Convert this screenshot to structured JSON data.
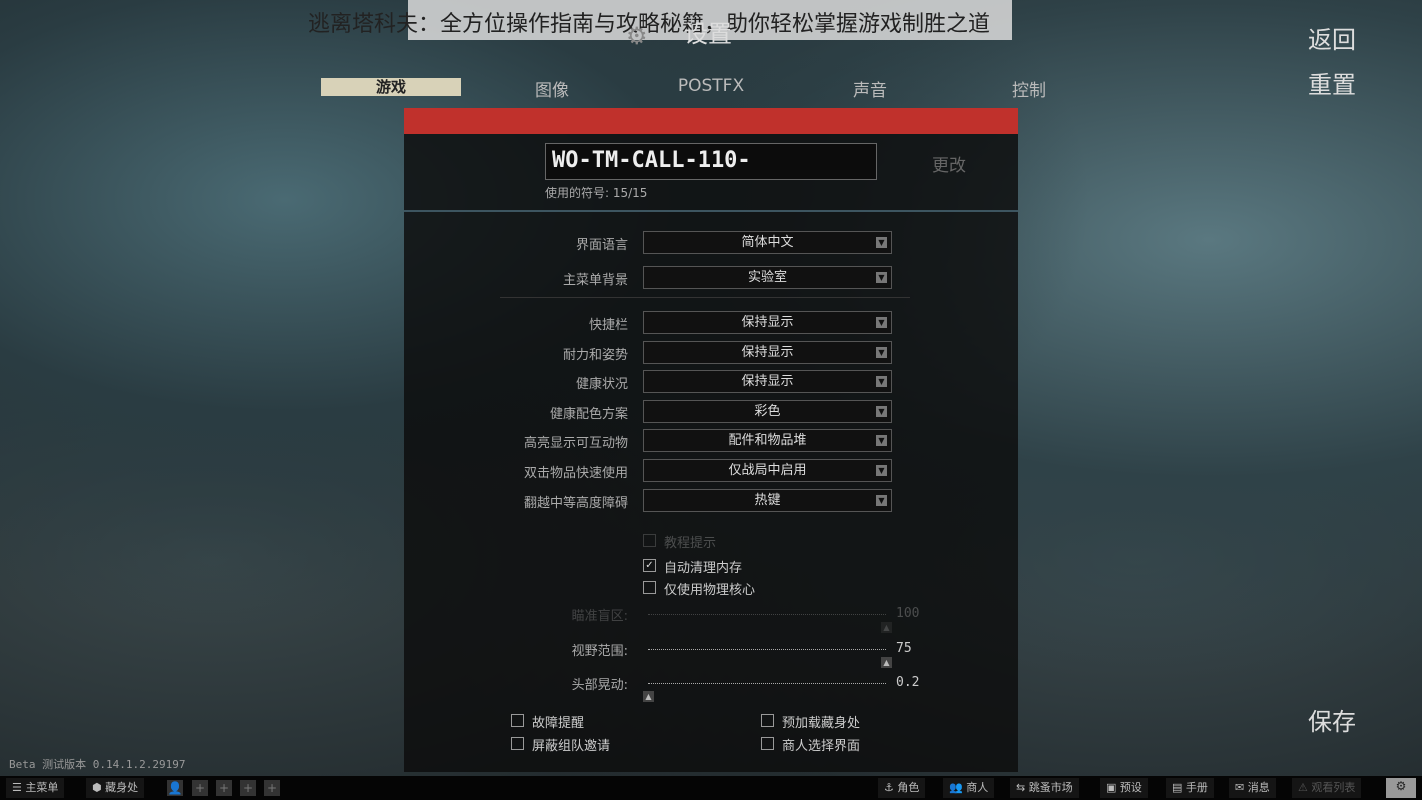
{
  "banner": "逃离塔科夫：全方位操作指南与攻略秘籍，助你轻松掌握游戏制胜之道",
  "title": "设置",
  "tabs": [
    {
      "label": "游戏",
      "active": true
    },
    {
      "label": "图像"
    },
    {
      "label": "POSTFX"
    },
    {
      "label": "声音"
    },
    {
      "label": "控制"
    }
  ],
  "right_buttons": {
    "back": "返回",
    "reset": "重置",
    "save": "保存"
  },
  "profile": {
    "name": "WO-TM-CALL-110-",
    "symbols_used": "使用的符号: 15/15",
    "change": "更改"
  },
  "settings": [
    {
      "label": "界面语言",
      "value": "简体中文"
    },
    {
      "label": "主菜单背景",
      "value": "实验室"
    },
    {
      "label": "快捷栏",
      "value": "保持显示"
    },
    {
      "label": "耐力和姿势",
      "value": "保持显示"
    },
    {
      "label": "健康状况",
      "value": "保持显示"
    },
    {
      "label": "健康配色方案",
      "value": "彩色"
    },
    {
      "label": "高亮显示可互动物",
      "value": "配件和物品堆"
    },
    {
      "label": "双击物品快速使用",
      "value": "仅战局中启用"
    },
    {
      "label": "翻越中等高度障碍",
      "value": "热键"
    }
  ],
  "checks": [
    {
      "label": "教程提示",
      "checked": false,
      "disabled": true
    },
    {
      "label": "自动清理内存",
      "checked": true
    },
    {
      "label": "仅使用物理核心",
      "checked": false
    }
  ],
  "sliders": [
    {
      "label": "瞄准盲区:",
      "value": "100",
      "disabled": true,
      "fraction": 1.0
    },
    {
      "label": "视野范围:",
      "value": "75",
      "fraction": 1.0
    },
    {
      "label": "头部晃动:",
      "value": "0.2",
      "fraction": 0.0
    }
  ],
  "bottom_checks": [
    {
      "label": "故障提醒",
      "checked": false
    },
    {
      "label": "预加载藏身处",
      "checked": false
    },
    {
      "label": "屏蔽组队邀请",
      "checked": false
    },
    {
      "label": "商人选择界面",
      "checked": false
    }
  ],
  "version": "Beta 测试版本 0.14.1.2.29197",
  "taskbar": {
    "left": [
      "主菜单",
      "藏身处"
    ],
    "right": [
      "角色",
      "商人",
      "跳蚤市场",
      "预设",
      "手册",
      "消息",
      "观看列表"
    ]
  }
}
